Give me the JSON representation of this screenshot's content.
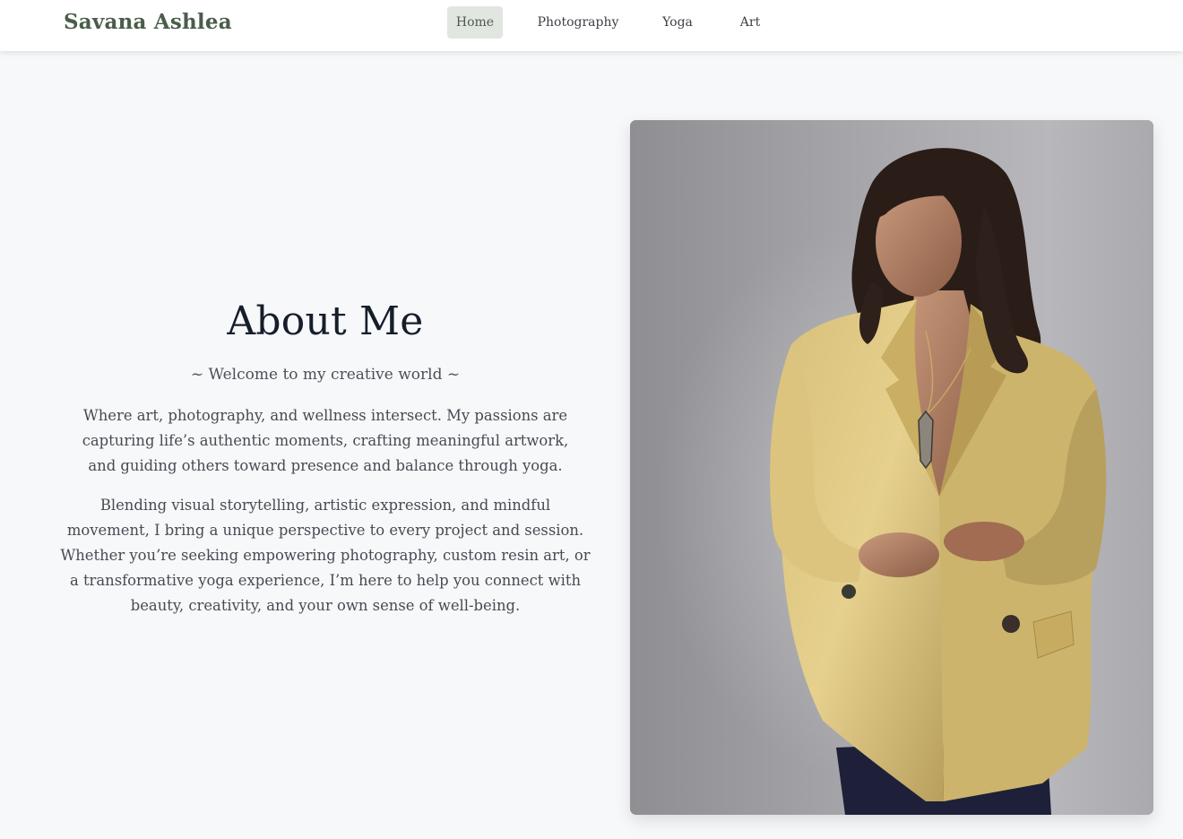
{
  "nav": {
    "brand": "Savana Ashlea",
    "links": [
      {
        "label": "Home",
        "active": true
      },
      {
        "label": "Photography",
        "active": false
      },
      {
        "label": "Yoga",
        "active": false
      },
      {
        "label": "Art",
        "active": false
      }
    ]
  },
  "about": {
    "title": "About Me",
    "tagline": "~ Welcome to my creative world ~",
    "paragraph1": "Where art, photography, and wellness intersect. My passions are capturing life’s authentic moments, crafting meaningful artwork, and guiding others toward presence and balance through yoga.",
    "paragraph2": "Blending visual storytelling, artistic expression, and mindful movement, I bring a unique perspective to every project and session. Whether you’re seeking empowering photography, custom resin art, or a transformative yoga experience, I’m here to help you connect with beauty, creativity, and your own sense of well-being."
  },
  "colors": {
    "brand": "#4a5d49",
    "active_nav_bg": "#e2e6e1",
    "page_bg": "#f7f8fa",
    "heading": "#161d2b",
    "body_text": "#464b53"
  }
}
